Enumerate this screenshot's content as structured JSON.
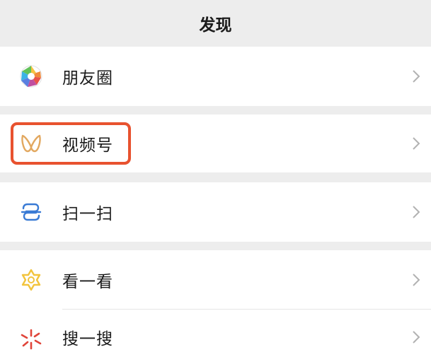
{
  "header": {
    "title": "发现"
  },
  "items": [
    {
      "label": "朋友圈",
      "icon": "moments-aperture-icon"
    },
    {
      "label": "视频号",
      "icon": "channels-butterfly-icon"
    },
    {
      "label": "扫一扫",
      "icon": "scan-icon"
    },
    {
      "label": "看一看",
      "icon": "top-stories-star-icon"
    },
    {
      "label": "搜一搜",
      "icon": "search-sparkle-icon"
    }
  ],
  "colors": {
    "background": "#ededed",
    "row_background": "#ffffff",
    "highlight": "#e8522f",
    "channels_icon": "#e2a860",
    "scan_icon": "#3a7bd5",
    "top_stories_icon": "#f2c43d",
    "search_icon": "#e0453a",
    "chevron": "#b2b2b2"
  }
}
